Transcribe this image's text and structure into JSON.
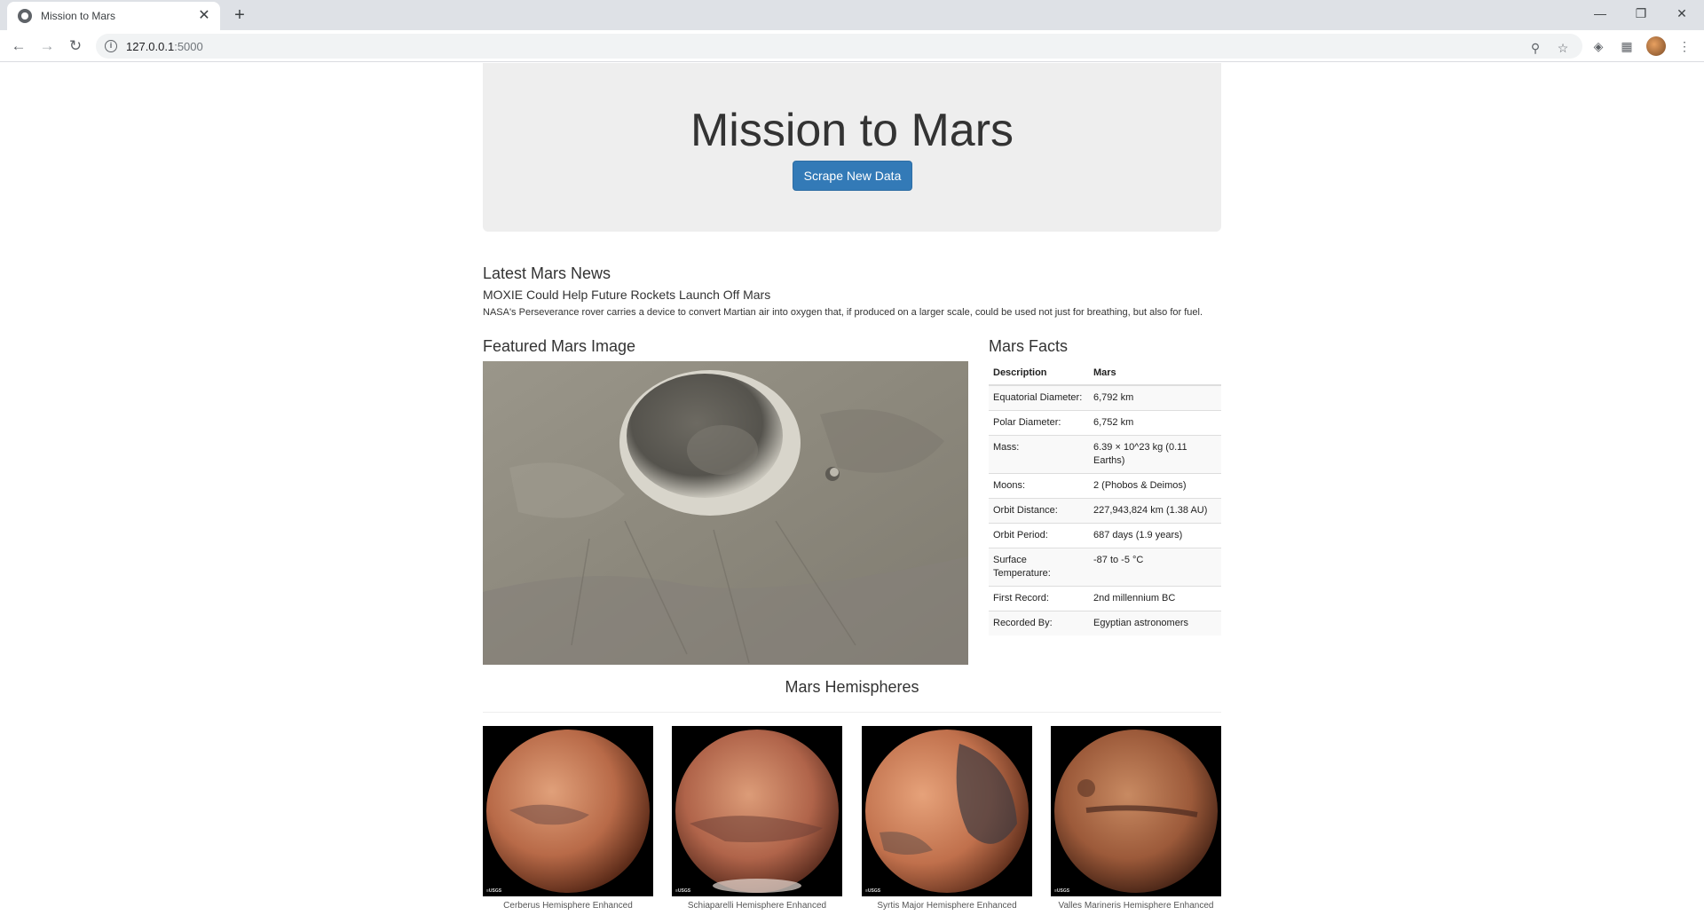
{
  "browser": {
    "tab_title": "Mission to Mars",
    "tab_close": "✕",
    "new_tab": "+",
    "url_host": "127.0.0.1",
    "url_port": ":5000"
  },
  "header": {
    "title": "Mission to Mars",
    "scrape_button": "Scrape New Data"
  },
  "news": {
    "heading": "Latest Mars News",
    "title": "MOXIE Could Help Future Rockets Launch Off Mars",
    "teaser": "NASA's Perseverance rover carries a device to convert Martian air into oxygen that, if produced on a larger scale, could be used not just for breathing, but also for fuel."
  },
  "featured": {
    "heading": "Featured Mars Image"
  },
  "facts": {
    "heading": "Mars Facts",
    "columns": [
      "Description",
      "Mars"
    ],
    "rows": [
      [
        "Equatorial Diameter:",
        "6,792 km"
      ],
      [
        "Polar Diameter:",
        "6,752 km"
      ],
      [
        "Mass:",
        "6.39 × 10^23 kg (0.11 Earths)"
      ],
      [
        "Moons:",
        "2 (Phobos & Deimos)"
      ],
      [
        "Orbit Distance:",
        "227,943,824 km (1.38 AU)"
      ],
      [
        "Orbit Period:",
        "687 days (1.9 years)"
      ],
      [
        "Surface Temperature:",
        "-87 to -5 °C"
      ],
      [
        "First Record:",
        "2nd millennium BC"
      ],
      [
        "Recorded By:",
        "Egyptian astronomers"
      ]
    ]
  },
  "hemispheres": {
    "heading": "Mars Hemispheres",
    "items": [
      {
        "title": "Cerberus Hemisphere Enhanced"
      },
      {
        "title": "Schiaparelli Hemisphere Enhanced"
      },
      {
        "title": "Syrtis Major Hemisphere Enhanced"
      },
      {
        "title": "Valles Marineris Hemisphere Enhanced"
      }
    ]
  }
}
